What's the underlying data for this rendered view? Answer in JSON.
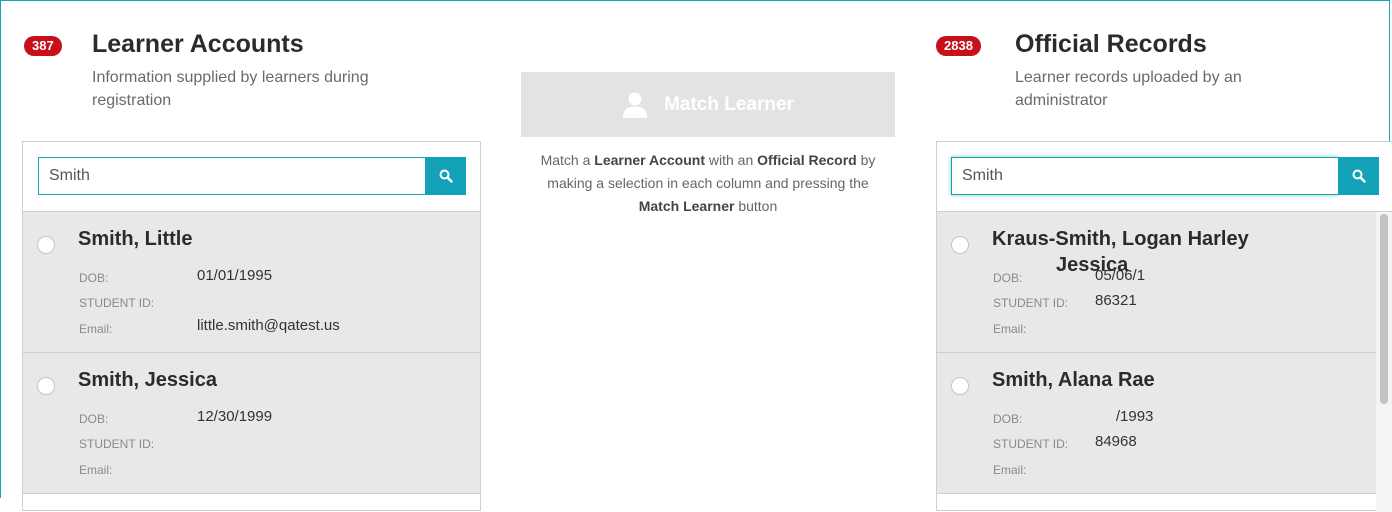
{
  "left": {
    "count": "387",
    "title": "Learner Accounts",
    "subtitle": "Information supplied by learners during registration",
    "search_value": "Smith",
    "records": [
      {
        "name": "Smith, Little",
        "dob_label": "DOB:",
        "dob": "01/01/1995",
        "sid_label": "STUDENT ID:",
        "sid": "",
        "email_label": "Email:",
        "email": "little.smith@qatest.us"
      },
      {
        "name": "Smith, Jessica",
        "dob_label": "DOB:",
        "dob": "12/30/1999",
        "sid_label": "STUDENT ID:",
        "sid": "",
        "email_label": "Email:",
        "email": ""
      }
    ]
  },
  "middle": {
    "match_label": "Match Learner",
    "instr_1": "Match a ",
    "instr_b1": "Learner Account",
    "instr_2": " with an ",
    "instr_b2": "Official Record",
    "instr_3": " by making a selection in each column and pressing the ",
    "instr_b3": "Match Learner",
    "instr_4": " button"
  },
  "right": {
    "count": "2838",
    "title": "Official Records",
    "subtitle": "Learner records uploaded by an administrator",
    "search_value": "Smith",
    "records": [
      {
        "name": "Kraus-Smith, Logan Harley",
        "dob_label": "DOB:",
        "dob": "05/06/1   ",
        "sid_label": "STUDENT ID:",
        "sid": "86321",
        "email_label": "Email:",
        "email": ""
      },
      {
        "name": "Smith, Alana Rae",
        "dob_label": "DOB:",
        "dob": "     /1993",
        "sid_label": "STUDENT ID:",
        "sid": "84968",
        "email_label": "Email:",
        "email": ""
      }
    ],
    "drag_overlay": "Jessica"
  },
  "colors": {
    "accent": "#13a2b8",
    "badge": "#c8101a",
    "row_bg": "#e8e8e8"
  },
  "icons": {
    "search": "search-icon",
    "user": "user-icon"
  }
}
